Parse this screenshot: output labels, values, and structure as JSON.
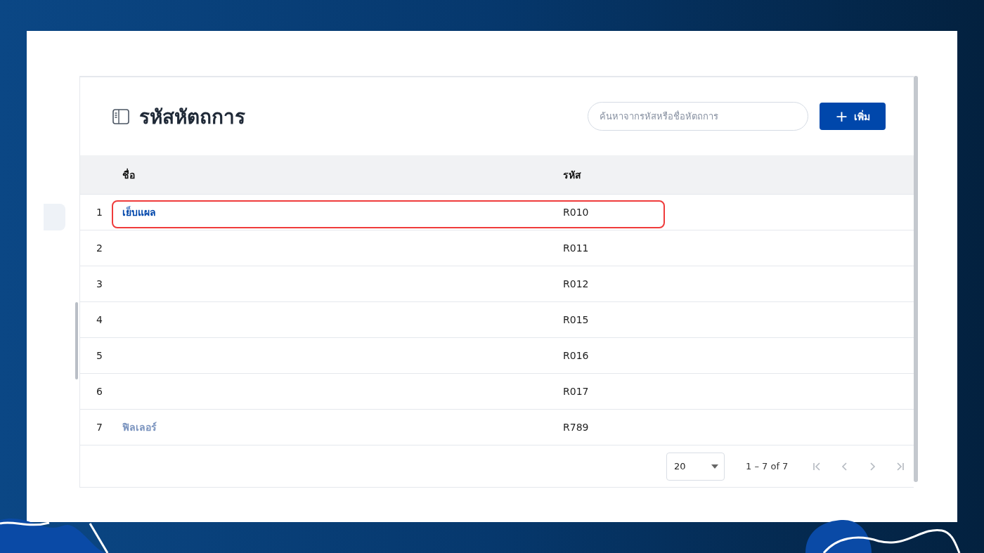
{
  "header": {
    "title": "รหัสหัตถการ",
    "search": {
      "placeholder": "ค้นหาจากรหัสหรือชื่อหัตถการ"
    },
    "add_button": {
      "icon": "+",
      "label": "เพิ่ม"
    }
  },
  "table": {
    "columns": [
      "ชื่อ",
      "รหัส"
    ],
    "rows": [
      {
        "index": "1",
        "name": {
          "text": "เย็บแผล",
          "faded": false
        },
        "code": "R010",
        "highlighted": true
      },
      {
        "index": "2",
        "code": "R011",
        "highlighted": false
      },
      {
        "index": "3",
        "code": "R012",
        "highlighted": false
      },
      {
        "index": "4",
        "code": "R015",
        "highlighted": false
      },
      {
        "index": "5",
        "code": "R016",
        "highlighted": false
      },
      {
        "index": "6",
        "code": "R017",
        "highlighted": false
      },
      {
        "index": "7",
        "name": {
          "text": "ฟิลเลอร์",
          "faded": true
        },
        "code": "R789",
        "highlighted": false
      }
    ]
  },
  "pagination": {
    "page_size": "20",
    "range": "1 – 7 of 7",
    "first_disabled": true,
    "prev_disabled": true,
    "next_disabled": true,
    "last_disabled": true
  }
}
